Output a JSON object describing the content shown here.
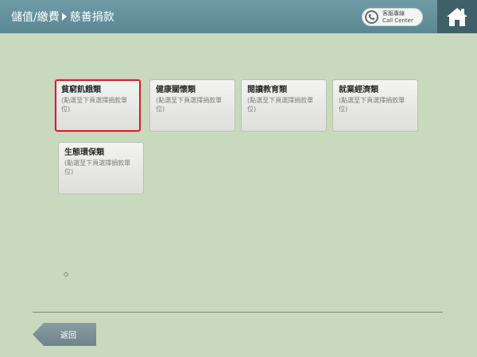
{
  "header": {
    "breadcrumb_parent": "儲值/繳費",
    "breadcrumb_current": "慈善捐款",
    "call_center_zh": "客服專線",
    "call_center_en": "Call Center"
  },
  "categories": [
    {
      "title": "貧窮飢餓類",
      "subtitle": "(點選至下頁選擇捐款單位)",
      "selected": true
    },
    {
      "title": "健康關懷類",
      "subtitle": "(點選至下頁選擇捐款單位)",
      "selected": false
    },
    {
      "title": "閱讀教育類",
      "subtitle": "(點選至下頁選擇捐款單位)",
      "selected": false
    },
    {
      "title": "就業經濟類",
      "subtitle": "(點選至下頁選擇捐款單位)",
      "selected": false
    },
    {
      "title": "生態環保類",
      "subtitle": "(點選至下頁選擇捐款單位)",
      "selected": false
    }
  ],
  "footer": {
    "marker": "◇",
    "back_label": "返回"
  },
  "icons": {
    "phone": "phone-icon",
    "home": "home-icon"
  },
  "colors": {
    "background": "#c9d9bd",
    "header": "#5b8793",
    "home": "#3e6068",
    "selected_border": "#cf2323"
  }
}
